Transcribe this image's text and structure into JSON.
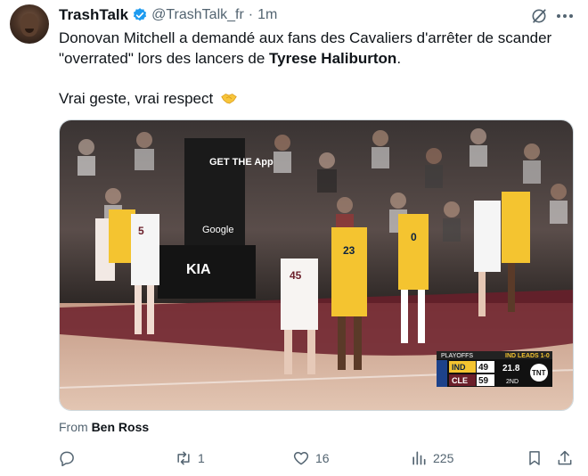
{
  "author": {
    "display_name": "TrashTalk",
    "handle": "@TrashTalk_fr",
    "separator": "·",
    "time": "1m"
  },
  "tweet": {
    "text_a": "Donovan Mitchell a demandé aux fans des Cavaliers d'arrêter de scander \"overrated\" lors des lancers de ",
    "text_bold": "Tyrese Haliburton",
    "text_b": ".",
    "line2": "Vrai geste, vrai respect",
    "emoji": "handshake-emoji"
  },
  "media": {
    "banner_text": "GET THE App",
    "court_ads": [
      "Google",
      "KIA"
    ],
    "jersey_numbers": [
      "5",
      "45",
      "23",
      "0"
    ],
    "scorebug": {
      "header": "PLAYOFFS",
      "series_status": "IND LEADS 1-0",
      "team1": "IND",
      "score1": "49",
      "team2": "CLE",
      "score2": "59",
      "clock": "21.8",
      "period": "2ND",
      "network": "TNT"
    }
  },
  "source": {
    "prefix": "From",
    "name": "Ben Ross"
  },
  "actions": {
    "reply": "",
    "retweet": "1",
    "like": "16",
    "views": "225"
  },
  "colors": {
    "text": "#0f1419",
    "secondary": "#536471",
    "verified": "#1d9bf0"
  }
}
